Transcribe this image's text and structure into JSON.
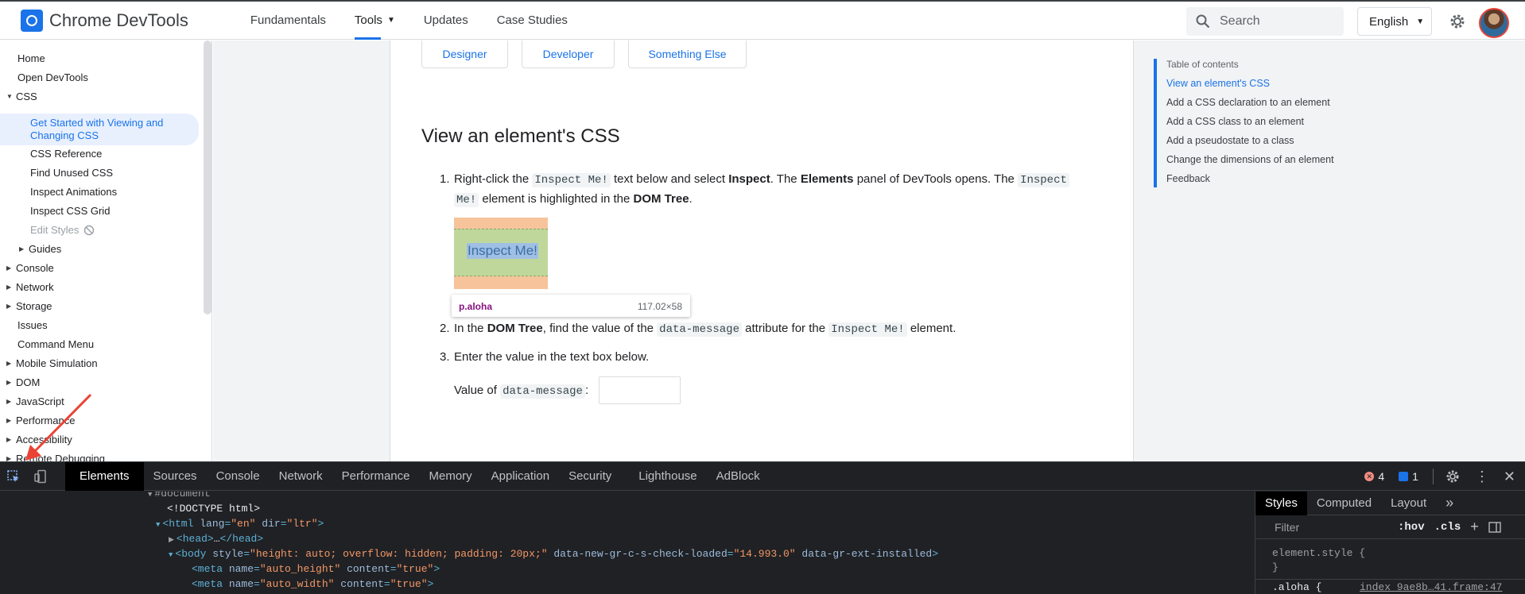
{
  "header": {
    "title": "Chrome DevTools",
    "nav": [
      "Fundamentals",
      "Tools",
      "Updates",
      "Case Studies"
    ],
    "search_placeholder": "Search",
    "language": "English"
  },
  "sidebar": {
    "items": [
      "Home",
      "Open DevTools",
      "CSS",
      "Get Started with Viewing and Changing CSS",
      "CSS Reference",
      "Find Unused CSS",
      "Inspect Animations",
      "Inspect CSS Grid",
      "Edit Styles",
      "Guides",
      "Console",
      "Network",
      "Storage",
      "Issues",
      "Command Menu",
      "Mobile Simulation",
      "DOM",
      "JavaScript",
      "Performance",
      "Accessibility",
      "Remote Debugging"
    ]
  },
  "main": {
    "chips": [
      "Designer",
      "Developer",
      "Something Else"
    ],
    "heading": "View an element's CSS",
    "step1": {
      "num": "1.",
      "a": "Right-click the ",
      "code1": "Inspect Me!",
      "b": " text below and select ",
      "inspect": "Inspect",
      "c": ". The ",
      "elements": "Elements",
      "d": " panel of DevTools opens. The ",
      "code2a": "Inspect",
      "code2b": "Me!",
      "e": " element is highlighted in the ",
      "dom": "DOM Tree",
      "f": "."
    },
    "demo_text": "Inspect Me!",
    "tooltip_class": "p.aloha",
    "tooltip_dims": "117.02×58",
    "step2": {
      "num": "2.",
      "a": "In the ",
      "dom": "DOM Tree",
      "b": ", find the value of the ",
      "code1": "data-message",
      "c": " attribute for the ",
      "code2": "Inspect Me!",
      "d": " element."
    },
    "step3": {
      "num": "3.",
      "text": "Enter the value in the text box below."
    },
    "value_label": "Value of ",
    "value_code": "data-message",
    "value_colon": ":"
  },
  "toc": {
    "title": "Table of contents",
    "items": [
      "View an element's CSS",
      "Add a CSS declaration to an element",
      "Add a CSS class to an element",
      "Add a pseudostate to a class",
      "Change the dimensions of an element",
      "Feedback"
    ]
  },
  "devtools": {
    "tabs": [
      "Elements",
      "Sources",
      "Console",
      "Network",
      "Performance",
      "Memory",
      "Application",
      "Security",
      "Lighthouse",
      "AdBlock"
    ],
    "errors": "4",
    "messages": "1",
    "dom": {
      "l0": "#document",
      "l1": "<!DOCTYPE html>",
      "l2": {
        "open": "<html ",
        "a1": "lang",
        "v1": "\"en\"",
        "a2": " dir",
        "v2": "\"ltr\"",
        "close": ">"
      },
      "l3": {
        "open": "<head>",
        "mid": "…",
        "close": "</head>"
      },
      "l4": {
        "open": "<body ",
        "a1": "style",
        "v1": "\"height: auto; overflow: hidden; padding: 20px;\"",
        "a2": " data-new-gr-c-s-check-loaded",
        "v2": "\"14.993.0\"",
        "a3": " data-gr-ext-installed",
        "close": ">"
      },
      "l5": {
        "open": "<meta ",
        "a1": "name",
        "v1": "\"auto_height\"",
        "a2": " content",
        "v2": "\"true\"",
        "close": ">"
      },
      "l6": {
        "open": "<meta ",
        "a1": "name",
        "v1": "\"auto_width\"",
        "a2": " content",
        "v2": "\"true\"",
        "close": ">"
      }
    },
    "styles": {
      "tabs": [
        "Styles",
        "Computed",
        "Layout"
      ],
      "more": "»",
      "filter": "Filter",
      "hov": ":hov",
      "cls": ".cls",
      "rule1": "element.style {",
      "rule1end": "}",
      "rule2": ".aloha {",
      "source": "index_9ae8b…41.frame:47"
    }
  }
}
